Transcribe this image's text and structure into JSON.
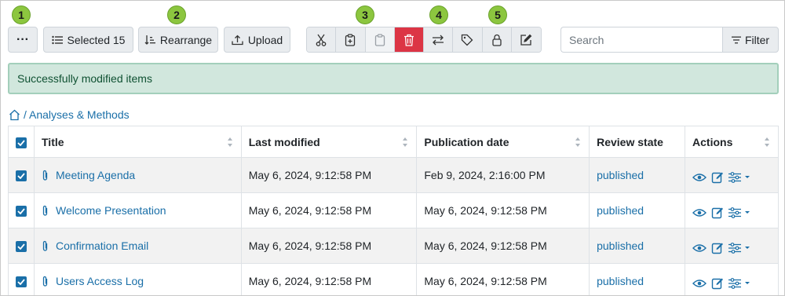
{
  "badges": [
    "1",
    "2",
    "3",
    "4",
    "5"
  ],
  "toolbar": {
    "more_label": "···",
    "selected_label": "Selected 15",
    "rearrange_label": "Rearrange",
    "upload_label": "Upload",
    "search_placeholder": "Search",
    "filter_label": "Filter"
  },
  "colors": {
    "accent": "#1a6fa8",
    "danger": "#dc3545",
    "success_bg": "#d1e7dd",
    "badge": "#8cc63f"
  },
  "icons": {
    "group": [
      "cut-icon",
      "copy-icon",
      "paste-icon",
      "delete-icon",
      "transfer-icon",
      "tag-icon",
      "lock-icon",
      "edit-icon"
    ]
  },
  "alert": {
    "message": "Successfully modified items"
  },
  "breadcrumb": {
    "path": "/ Analyses & Methods"
  },
  "table": {
    "headers": [
      "Title",
      "Last modified",
      "Publication date",
      "Review state",
      "Actions"
    ],
    "rows": [
      {
        "title": "Meeting Agenda",
        "last_modified": "May 6, 2024, 9:12:58 PM",
        "publication_date": "Feb 9, 2024, 2:16:00 PM",
        "review_state": "published"
      },
      {
        "title": "Welcome Presentation",
        "last_modified": "May 6, 2024, 9:12:58 PM",
        "publication_date": "May 6, 2024, 9:12:58 PM",
        "review_state": "published"
      },
      {
        "title": "Confirmation Email",
        "last_modified": "May 6, 2024, 9:12:58 PM",
        "publication_date": "May 6, 2024, 9:12:58 PM",
        "review_state": "published"
      },
      {
        "title": "Users Access Log",
        "last_modified": "May 6, 2024, 9:12:58 PM",
        "publication_date": "May 6, 2024, 9:12:58 PM",
        "review_state": "published"
      }
    ]
  }
}
